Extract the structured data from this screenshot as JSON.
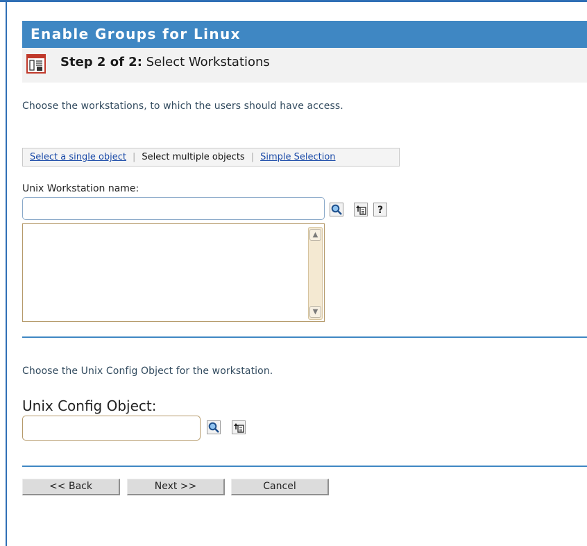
{
  "header": {
    "title": "Enable Groups for Linux",
    "step_prefix": "Step 2 of 2:",
    "step_title": "Select Workstations"
  },
  "workstations": {
    "instruction": "Choose the workstations, to which the users should have access.",
    "selection_tabs": {
      "single": "Select a single object",
      "multiple": "Select multiple objects",
      "simple": "Simple Selection"
    },
    "field_label": "Unix Workstation name:",
    "value": "",
    "list_items": []
  },
  "config": {
    "instruction": "Choose the Unix Config Object for the workstation.",
    "field_label": "Unix Config Object:",
    "value": ""
  },
  "buttons": {
    "back": "<< Back",
    "next": "Next >>",
    "cancel": "Cancel"
  },
  "icons": {
    "help_glyph": "?"
  },
  "colors": {
    "accent": "#3f87c3",
    "link": "#1a4aa8",
    "field_border": "#b59a6a"
  }
}
